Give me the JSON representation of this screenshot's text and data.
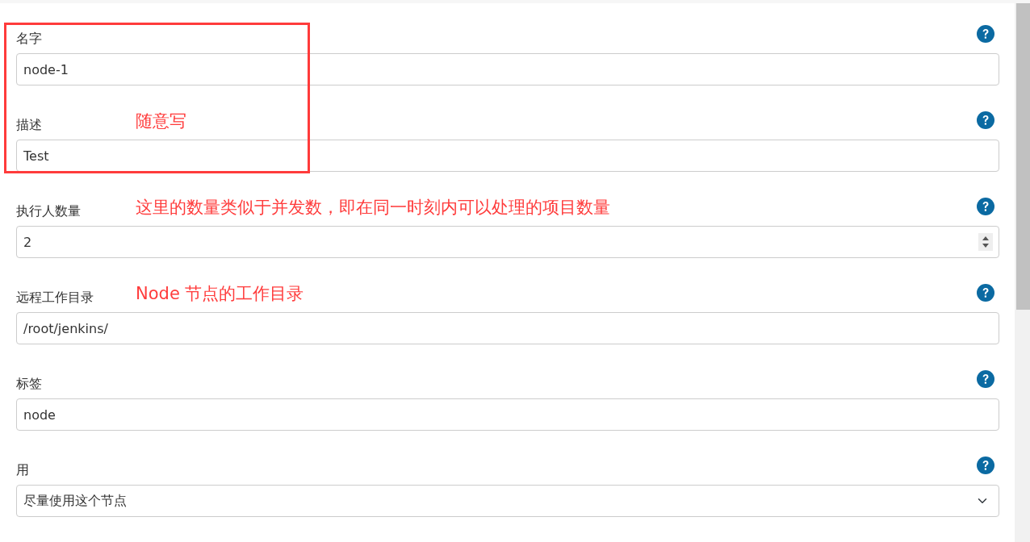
{
  "fields": [
    {
      "kind": "text",
      "label": "名字",
      "value": "node-1",
      "in_red_box": true
    },
    {
      "kind": "text",
      "label": "描述",
      "value": "Test",
      "in_red_box": true,
      "annotation": "随意写"
    },
    {
      "kind": "number",
      "label": "执行人数量",
      "value": "2",
      "in_red_box": false,
      "annotation": "这里的数量类似于并发数，即在同一时刻内可以处理的项目数量"
    },
    {
      "kind": "text",
      "label": "远程工作目录",
      "value": "/root/jenkins/",
      "in_red_box": false,
      "annotation": "Node 节点的工作目录"
    },
    {
      "kind": "text",
      "label": "标签",
      "value": "node",
      "in_red_box": false
    },
    {
      "kind": "select",
      "label": "用",
      "value": "尽量使用这个节点",
      "in_red_box": false
    }
  ]
}
